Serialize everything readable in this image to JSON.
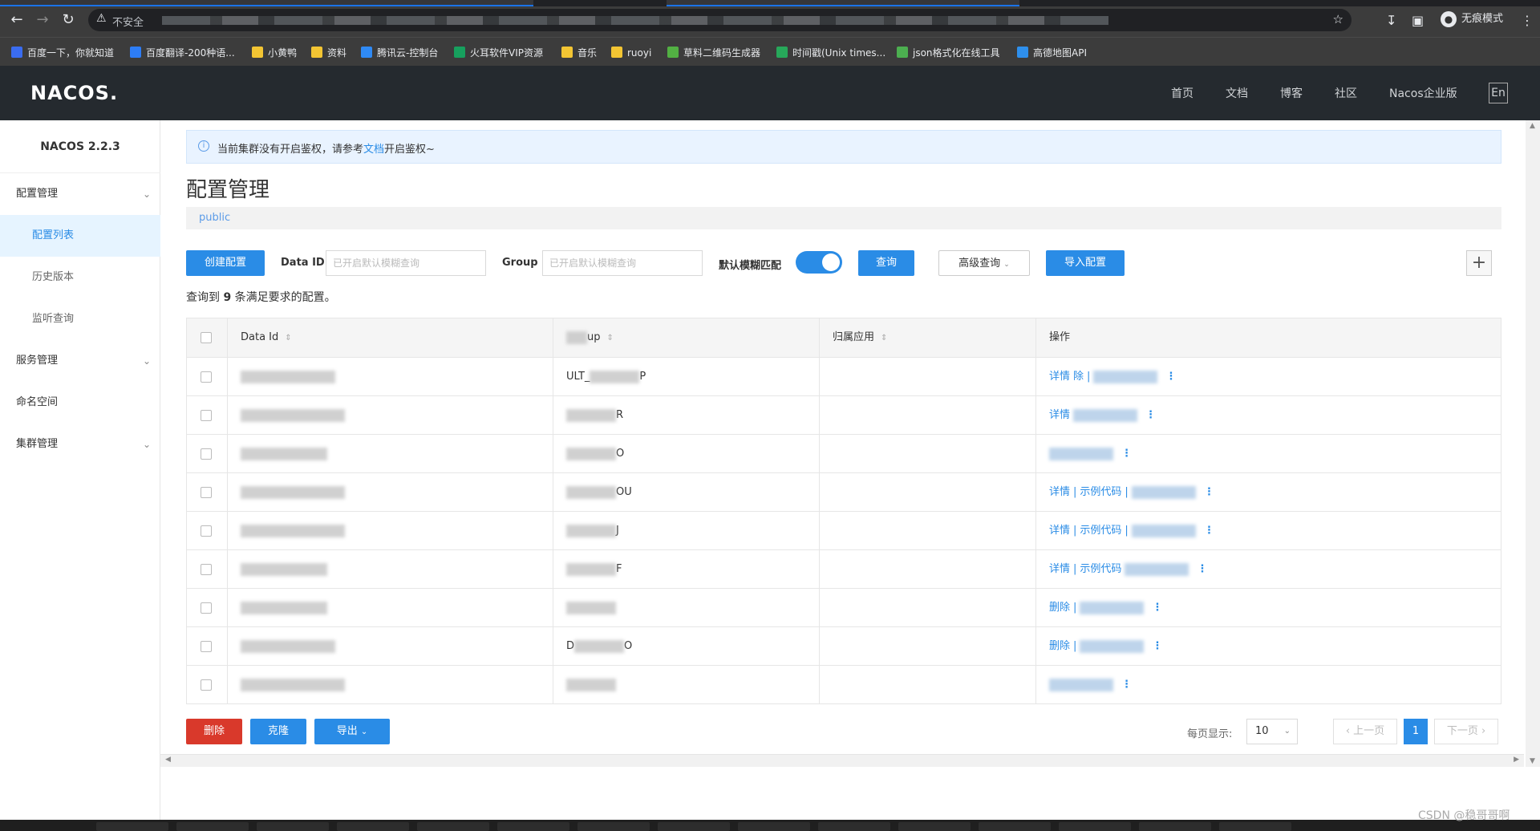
{
  "browser": {
    "address_warning": "不安全",
    "incognito_label": "无痕模式"
  },
  "bookmarks": [
    {
      "label": "百度一下，你就知道",
      "color": "#3a6cf0"
    },
    {
      "label": "百度翻译-200种语...",
      "color": "#2d7df6"
    },
    {
      "label": "小黄鸭",
      "color": "#f3c533"
    },
    {
      "label": "资料",
      "color": "#f3c533"
    },
    {
      "label": "腾讯云-控制台",
      "color": "#2f8af5"
    },
    {
      "label": "火耳软件VIP资源",
      "color": "#17a05e"
    },
    {
      "label": "音乐",
      "color": "#f3c533"
    },
    {
      "label": "ruoyi",
      "color": "#f3c533"
    },
    {
      "label": "草料二维码生成器",
      "color": "#52b043"
    },
    {
      "label": "时间戳(Unix times...",
      "color": "#27a85a"
    },
    {
      "label": "json格式化在线工具",
      "color": "#4caf50"
    },
    {
      "label": "高德地图API",
      "color": "#2e8fec"
    }
  ],
  "topnav": {
    "logo": "NACOS.",
    "items": [
      "首页",
      "文档",
      "博客",
      "社区",
      "Nacos企业版"
    ],
    "lang": "En"
  },
  "sidebar": {
    "version": "NACOS 2.2.3",
    "items": [
      {
        "label": "配置管理",
        "type": "top",
        "expandable": true
      },
      {
        "label": "配置列表",
        "type": "sub",
        "active": true
      },
      {
        "label": "历史版本",
        "type": "sub"
      },
      {
        "label": "监听查询",
        "type": "sub"
      },
      {
        "label": "服务管理",
        "type": "top",
        "expandable": true
      },
      {
        "label": "命名空间",
        "type": "top"
      },
      {
        "label": "集群管理",
        "type": "top",
        "expandable": true
      }
    ]
  },
  "notice": {
    "before": "当前集群没有开启鉴权，请参考",
    "link": "文档",
    "after": "开启鉴权~"
  },
  "page": {
    "title": "配置管理",
    "namespace": "public"
  },
  "toolbar": {
    "create_label": "创建配置",
    "dataid_label": "Data ID",
    "dataid_placeholder": "已开启默认模糊查询",
    "group_label": "Group",
    "group_placeholder": "已开启默认模糊查询",
    "fuzzy_label": "默认模糊匹配",
    "fuzzy_on": true,
    "query_label": "查询",
    "advanced_label": "高级查询",
    "import_label": "导入配置"
  },
  "result": {
    "prefix": "查询到",
    "count": "9",
    "suffix": "条满足要求的配置。"
  },
  "table": {
    "headers": [
      "Data Id",
      "up",
      "归属应用",
      "操作"
    ],
    "rows": [
      {
        "group_partial": "ULT_",
        "group_tail": "P",
        "ops": [
          "详情",
          "除",
          "|"
        ]
      },
      {
        "group_partial": "",
        "group_tail": "R",
        "ops": [
          "详情"
        ]
      },
      {
        "group_partial": "",
        "group_tail": "O",
        "ops": []
      },
      {
        "group_partial": "",
        "group_tail": "OU",
        "ops": [
          "详情",
          "|",
          "示例代码",
          "|"
        ]
      },
      {
        "group_partial": "",
        "group_tail": "J",
        "ops": [
          "详情",
          "|",
          "示例代码",
          "|"
        ]
      },
      {
        "group_partial": "",
        "group_tail": "F",
        "ops": [
          "详情",
          "|",
          "示例代码"
        ]
      },
      {
        "group_partial": "",
        "group_tail": "",
        "ops": [
          "删除",
          "|"
        ]
      },
      {
        "group_partial": "D",
        "group_tail": "O",
        "ops": [
          "删除",
          "|"
        ]
      },
      {
        "group_partial": "",
        "group_tail": "",
        "ops": []
      }
    ]
  },
  "footer": {
    "delete_label": "删除",
    "clone_label": "克隆",
    "export_label": "导出",
    "page_size_label": "每页显示:",
    "page_size": "10",
    "prev_label": "上一页",
    "current_page": "1",
    "next_label": "下一页"
  },
  "watermark": "CSDN @稳哥哥啊"
}
